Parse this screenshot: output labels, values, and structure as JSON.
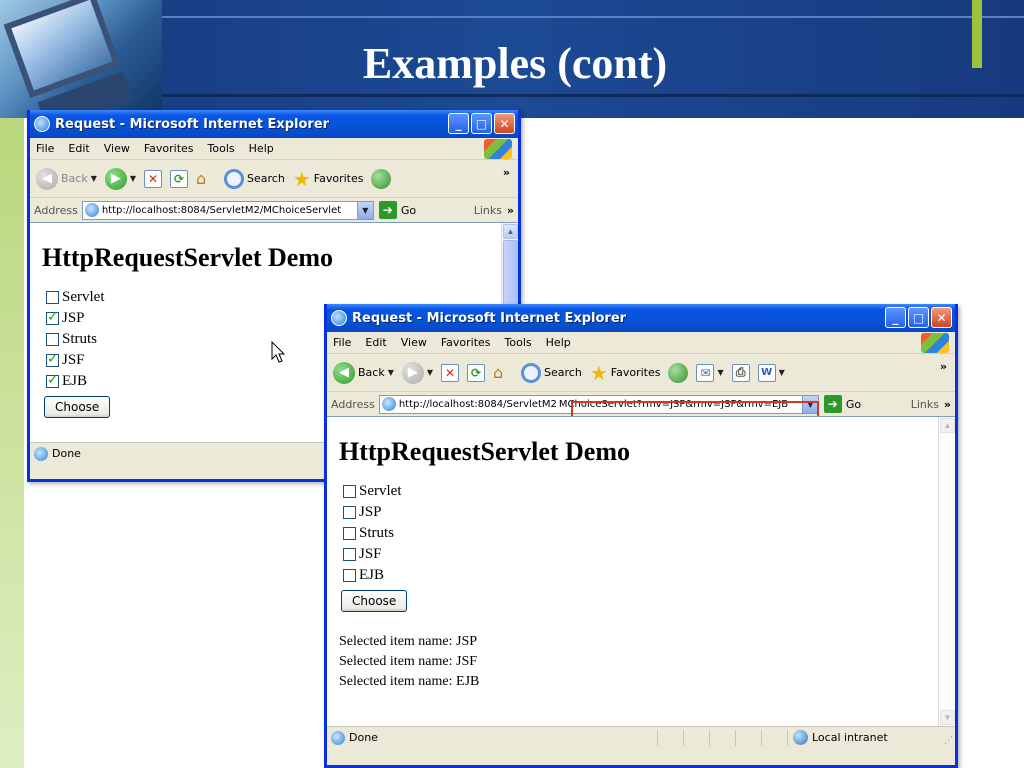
{
  "slide": {
    "title": "Examples (cont)"
  },
  "window_back": {
    "title": "Request - Microsoft Internet Explorer",
    "menu": [
      "File",
      "Edit",
      "View",
      "Favorites",
      "Tools",
      "Help"
    ],
    "toolbar": {
      "back": "Back",
      "search": "Search",
      "favorites": "Favorites"
    },
    "address": {
      "label": "Address",
      "url": "http://localhost:8084/ServletM2/MChoiceServlet",
      "go": "Go",
      "links": "Links"
    },
    "content": {
      "heading": "HttpRequestServlet Demo",
      "options": [
        {
          "label": "Servlet",
          "checked": false
        },
        {
          "label": "JSP",
          "checked": true
        },
        {
          "label": "Struts",
          "checked": false
        },
        {
          "label": "JSF",
          "checked": true
        },
        {
          "label": "EJB",
          "checked": true
        }
      ],
      "button": "Choose"
    },
    "status": "Done"
  },
  "window_front": {
    "title": "Request - Microsoft Internet Explorer",
    "menu": [
      "File",
      "Edit",
      "View",
      "Favorites",
      "Tools",
      "Help"
    ],
    "toolbar": {
      "back": "Back",
      "search": "Search",
      "favorites": "Favorites"
    },
    "address": {
      "label": "Address",
      "url_prefix": "http://localhost:8084/ServletM2",
      "url_query": "MChoiceServlet?rmv=JSP&rmv=JSF&rmv=EJB",
      "go": "Go",
      "links": "Links"
    },
    "content": {
      "heading": "HttpRequestServlet Demo",
      "options": [
        {
          "label": "Servlet",
          "checked": false
        },
        {
          "label": "JSP",
          "checked": false
        },
        {
          "label": "Struts",
          "checked": false
        },
        {
          "label": "JSF",
          "checked": false
        },
        {
          "label": "EJB",
          "checked": false
        }
      ],
      "button": "Choose",
      "selected": [
        "Selected item name: JSP",
        "Selected item name: JSF",
        "Selected item name: EJB"
      ]
    },
    "status": "Done",
    "zone": "Local intranet"
  },
  "colors": {
    "slide_header": "#1c4a94",
    "xp_title_blue": "#0653d6",
    "url_highlight": "#d13a1c",
    "accent_green": "#9dc23b"
  }
}
